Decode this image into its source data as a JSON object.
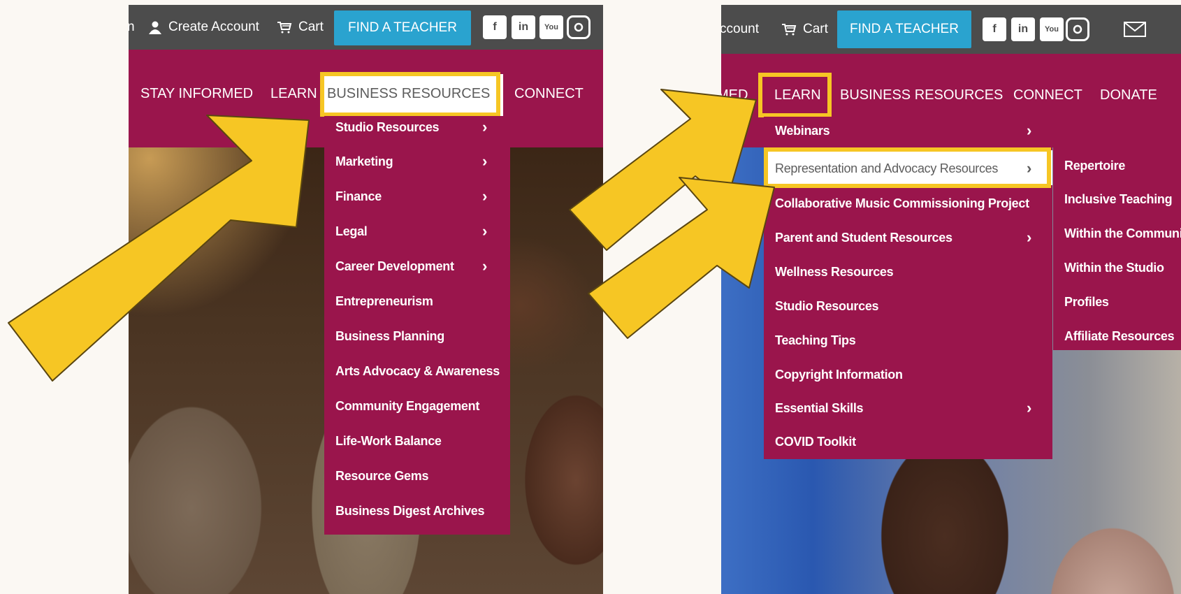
{
  "colors": {
    "page_bg": "#fbf8f3",
    "topbar_bg": "#4c4c4c",
    "brand_magenta": "#9a154c",
    "find_teacher_blue": "#2aa3cf",
    "highlight_yellow": "#f6c624",
    "arrow_yellow": "#f6c624"
  },
  "left_panel": {
    "topbar": {
      "truncated_left": "n",
      "create_account": "Create Account",
      "cart": "Cart",
      "find_teacher": "FIND A TEACHER",
      "social_icons": [
        "facebook-icon",
        "linkedin-icon",
        "youtube-icon",
        "instagram-icon"
      ]
    },
    "nav": {
      "items": [
        "STAY INFORMED",
        "LEARN",
        "BUSINESS RESOURCES",
        "CONNECT"
      ],
      "highlighted": "BUSINESS RESOURCES"
    },
    "dropdown": [
      {
        "label": "Studio Resources",
        "submenu": true
      },
      {
        "label": "Marketing",
        "submenu": true
      },
      {
        "label": "Finance",
        "submenu": true
      },
      {
        "label": "Legal",
        "submenu": true
      },
      {
        "label": "Career Development",
        "submenu": true
      },
      {
        "label": "Entrepreneurism",
        "submenu": false
      },
      {
        "label": "Business Planning",
        "submenu": false
      },
      {
        "label": "Arts Advocacy & Awareness",
        "submenu": false
      },
      {
        "label": "Community Engagement",
        "submenu": false
      },
      {
        "label": "Life-Work Balance",
        "submenu": false
      },
      {
        "label": "Resource Gems",
        "submenu": false
      },
      {
        "label": "Business Digest Archives",
        "submenu": false
      }
    ]
  },
  "right_panel": {
    "topbar": {
      "truncated_account": "ccount",
      "cart": "Cart",
      "find_teacher": "FIND A TEACHER",
      "social_icons": [
        "facebook-icon",
        "linkedin-icon",
        "youtube-icon",
        "instagram-icon"
      ],
      "mail_icon": "mail-icon"
    },
    "nav": {
      "items": [
        "MED",
        "LEARN",
        "BUSINESS RESOURCES",
        "CONNECT",
        "DONATE"
      ],
      "highlighted": "LEARN"
    },
    "dropdown": [
      {
        "label": "Webinars",
        "submenu": true
      },
      {
        "label": "Representation and Advocacy Resources",
        "submenu": true,
        "selected": true
      },
      {
        "label": "Collaborative Music Commissioning Project",
        "submenu": false
      },
      {
        "label": "Parent and Student Resources",
        "submenu": true
      },
      {
        "label": "Wellness Resources",
        "submenu": false
      },
      {
        "label": "Studio Resources",
        "submenu": false
      },
      {
        "label": "Teaching Tips",
        "submenu": false
      },
      {
        "label": "Copyright Information",
        "submenu": false
      },
      {
        "label": "Essential Skills",
        "submenu": true
      },
      {
        "label": "COVID Toolkit",
        "submenu": false
      }
    ],
    "submenu": [
      "Repertoire",
      "Inclusive Teaching",
      "Within the Communit",
      "Within the Studio",
      "Profiles",
      "Affiliate Resources"
    ]
  }
}
